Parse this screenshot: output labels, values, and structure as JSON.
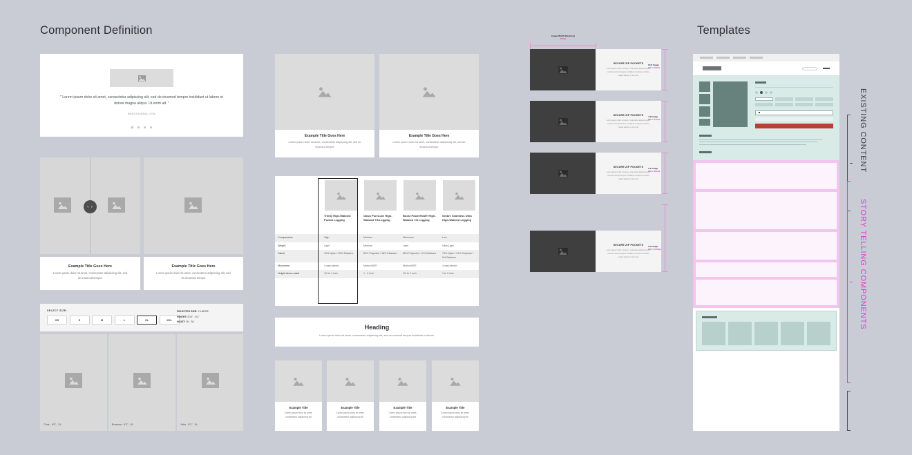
{
  "sections": {
    "component_definition_title": "Component Definition",
    "templates_title": "Templates"
  },
  "column1": {
    "quote_block": {
      "quote": "\" Lorem ipsum dolor sit amet, consectetur adipiscing elit, sed do eiusmod tempor incididunt ut labore et dolore magna aliqua. Ut enim ad. \"",
      "source": "MENSJOURNAL.COM",
      "dot_count": 4,
      "active_dot": 1
    },
    "carousel": {
      "arrow_icon": "chevron-left-right-icon",
      "arrow_label": "‹ ›"
    },
    "captions": [
      {
        "title": "Example Title Goes Here",
        "body": "Lorem ipsum dolor sit amet, consectetur adipiscing elit, sed do eiusmod tempor"
      },
      {
        "title": "Example Title Goes Here",
        "body": "Lorem ipsum dolor sit amet, consectetur adipiscing elit, sed do eiusmod tempor"
      }
    ],
    "size_selector": {
      "label": "SELECT SIZE:",
      "sizes": [
        "XS",
        "S",
        "M",
        "L",
        "XL",
        "XXL"
      ],
      "selected": "XL",
      "info": [
        {
          "key": "SELECTED SIZE:",
          "value": " X LARGE"
        },
        {
          "key": "HEIGHT:",
          "value": " 5'10\" - 6'2\""
        },
        {
          "key": "WAIST:",
          "value": " 36 - 38"
        }
      ]
    },
    "models": [
      {
        "label": "Chris - 6'0\" - XL"
      },
      {
        "label": "Brannon - 6'2\" - XL"
      },
      {
        "label": "John - 6'1\" - XL"
      }
    ]
  },
  "column2": {
    "two_up": [
      {
        "title": "Example Title Goes Here",
        "body": "Lorem ipsum dolor sit amet, consectetur adipiscing elit, sed do eiusmod tempor"
      },
      {
        "title": "Example Title Goes Here",
        "body": "Lorem ipsum dolor sit amet, consectetur adipiscing elit, sed do eiusmod tempor"
      }
    ],
    "comparison_table": {
      "highlighted_column": 0,
      "columns": [
        "Trinity High-Waisted Pocket Legging",
        "Oasis PureLuxe High-Waisted 7/8 Legging",
        "Boost PowerHold® High-Waisted 7/8 Legging",
        "Ombre Seamless Ultra High-Waisted Legging"
      ],
      "rows": [
        {
          "label": "Compression",
          "values": [
            "High",
            "Medium",
            "Maximum",
            "Low"
          ]
        },
        {
          "label": "Weight",
          "values": [
            "Light",
            "Medium",
            "Light",
            "Ultra-Light"
          ]
        },
        {
          "label": "Fabric",
          "values": [
            "75% Nylon / 25% Elastane",
            "82% Polyester / 18% Elastane",
            "88% Polyester / 12% Elastane",
            "73% Nylon / 21% Polyester / 6% Elastane"
          ]
        },
        {
          "label": "Movement",
          "values": [
            "4-way-stretch",
            "Motion350®",
            "Motion350®",
            "4-way-stretch"
          ]
        },
        {
          "label": "Height above waist",
          "values": [
            "1/2 to 1 inch",
            "1 - 2 inch",
            "1/2 to 1 inch",
            "1 to 2 inch"
          ]
        }
      ]
    },
    "heading_block": {
      "title": "Heading",
      "body": "Lorem ipsum dolor sit amet, consectetur adipiscing elit, sed do eiusmod tempor incididunt ut labore."
    },
    "four_up": [
      {
        "title": "Example Title",
        "body": "Lorem ipsum dolor sit amet, consectetur adipiscing elit"
      },
      {
        "title": "Example Title",
        "body": "Lorem ipsum dolor sit amet, consectetur adipiscing elit"
      },
      {
        "title": "Example Title",
        "body": "Lorem ipsum dolor sit amet, consectetur adipiscing elit"
      },
      {
        "title": "Example Title",
        "body": "Lorem ipsum dolor sit amet, consectetur adipiscing elit"
      }
    ]
  },
  "column3": {
    "width_annotation": {
      "label": "Image Width (Desktop)",
      "value": "900px"
    },
    "cards": [
      {
        "heading": "SECURE ZIP POCKETS",
        "body": "Lorem ipsum dolor sit amet, consectetur adipiscing elit, sed do eiusmod tempor incididunt ut labore et dolore magna aliqua. Ut enim ad.",
        "ratio_label": "16:9 Image",
        "ratio_value": "900 x 506px"
      },
      {
        "heading": "SECURE ZIP POCKETS",
        "body": "Lorem ipsum dolor sit amet, consectetur adipiscing elit, sed do eiusmod tempor incididunt ut labore et dolore magna aliqua. Ut enim ad.",
        "ratio_label": "4:3 Image",
        "ratio_value": "900 x 675px"
      },
      {
        "heading": "SECURE ZIP POCKETS",
        "body": "Lorem ipsum dolor sit amet, consectetur adipiscing elit, sed do eiusmod tempor incididunt ut labore et dolore magna aliqua. Ut enim ad.",
        "ratio_label": "1:1 Image",
        "ratio_value": "900 x 900px"
      },
      {
        "heading": "SECURE ZIP POCKETS",
        "body": "Lorem ipsum dolor sit amet, consectetur adipiscing elit, sed do eiusmod tempor incididunt ut labore et dolore magna aliqua. Ut enim ad.",
        "ratio_label": "3:4 Image",
        "ratio_value": "900 x 1200px"
      }
    ]
  },
  "column4": {
    "brackets": [
      {
        "label": "EXISTING CONTENT",
        "color": "#3a3d42"
      },
      {
        "label": "STORY TELLING COMPONENTS",
        "color": "#e040c8"
      }
    ]
  },
  "colors": {
    "page_background": "#c9ccd4",
    "placeholder_grey": "#dcdcdc",
    "dark_image": "#3f3f3f",
    "accent_pink": "#e040c8",
    "template_green": "#d8ebe7",
    "template_green_dark": "#67817d",
    "cta_red": "#bf3b36"
  }
}
